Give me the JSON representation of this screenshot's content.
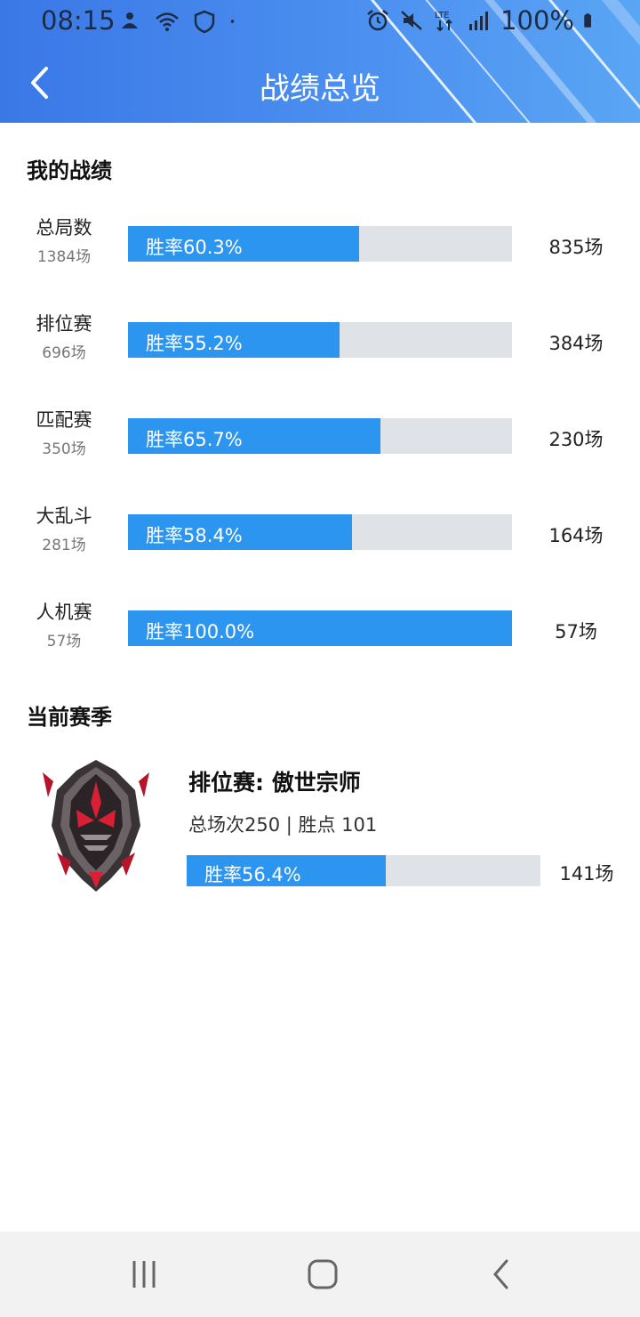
{
  "status_bar": {
    "time": "08:15",
    "battery": "100%",
    "left_icons": [
      "game-icon",
      "wifi-icon",
      "shield-icon",
      "dot-icon"
    ],
    "right_icons": [
      "alarm-icon",
      "mute-icon",
      "lte-icon",
      "signal-icon",
      "battery-icon"
    ],
    "lte_label": "LTE"
  },
  "header": {
    "title": "战绩总览",
    "back_icon": "chevron-left-icon"
  },
  "my_stats": {
    "title": "我的战绩",
    "rows": [
      {
        "label": "总局数",
        "sub": "1384场",
        "win_rate": "胜率60.3%",
        "ratio": 0.603,
        "count": "835场"
      },
      {
        "label": "排位赛",
        "sub": "696场",
        "win_rate": "胜率55.2%",
        "ratio": 0.552,
        "count": "384场"
      },
      {
        "label": "匹配赛",
        "sub": "350场",
        "win_rate": "胜率65.7%",
        "ratio": 0.657,
        "count": "230场"
      },
      {
        "label": "大乱斗",
        "sub": "281场",
        "win_rate": "胜率58.4%",
        "ratio": 0.584,
        "count": "164场"
      },
      {
        "label": "人机赛",
        "sub": "57场",
        "win_rate": "胜率100.0%",
        "ratio": 1.0,
        "count": "57场"
      }
    ]
  },
  "current_season": {
    "title": "当前赛季",
    "rank_title": "排位赛: 傲世宗师",
    "detail": "总场次250 | 胜点 101",
    "win_rate": "胜率56.4%",
    "ratio": 0.564,
    "count": "141场",
    "emblem_icon": "grandmaster-emblem-icon"
  },
  "colors": {
    "accent": "#2c95ef",
    "track": "#dfe2e7",
    "header_start": "#3a78e6",
    "header_end": "#5aa5f4"
  },
  "nav": {
    "icons": [
      "recent-apps-icon",
      "home-icon",
      "back-icon"
    ]
  }
}
